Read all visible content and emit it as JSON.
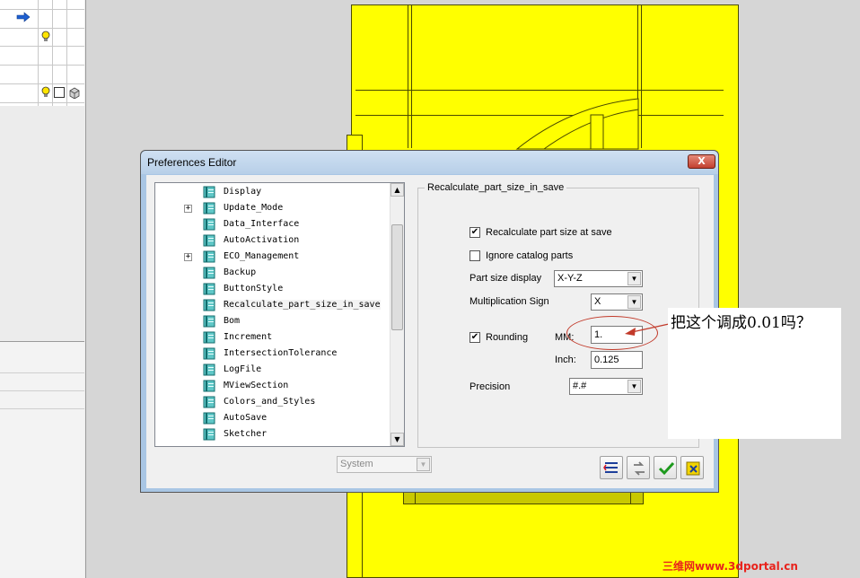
{
  "dialog": {
    "title": "Preferences Editor",
    "close_label": "X"
  },
  "tree": {
    "items": [
      {
        "label": "Display",
        "expandable": false
      },
      {
        "label": "Update_Mode",
        "expandable": true
      },
      {
        "label": "Data_Interface",
        "expandable": false
      },
      {
        "label": "AutoActivation",
        "expandable": false
      },
      {
        "label": "ECO_Management",
        "expandable": true
      },
      {
        "label": "Backup",
        "expandable": false
      },
      {
        "label": "ButtonStyle",
        "expandable": false
      },
      {
        "label": "Recalculate_part_size_in_save",
        "expandable": false,
        "selected": true
      },
      {
        "label": "Bom",
        "expandable": false
      },
      {
        "label": "Increment",
        "expandable": false
      },
      {
        "label": "IntersectionTolerance",
        "expandable": false
      },
      {
        "label": "LogFile",
        "expandable": false
      },
      {
        "label": "MViewSection",
        "expandable": false
      },
      {
        "label": "Colors_and_Styles",
        "expandable": false
      },
      {
        "label": "AutoSave",
        "expandable": false
      },
      {
        "label": "Sketcher",
        "expandable": false
      }
    ],
    "expand_symbol": "+"
  },
  "panel": {
    "group_title": "Recalculate_part_size_in_save",
    "recalc_label": "Recalculate part size at save",
    "recalc_checked": true,
    "ignore_label": "Ignore catalog parts",
    "ignore_checked": false,
    "part_size_label": "Part size display",
    "part_size_value": "X-Y-Z",
    "mult_label": "Multiplication Sign",
    "mult_value": "X",
    "rounding_label": "Rounding",
    "rounding_checked": true,
    "mm_label": "MM:",
    "mm_value": "1.",
    "inch_label": "Inch:",
    "inch_value": "0.125",
    "precision_label": "Precision",
    "precision_value": "#.#",
    "check_mark": "✔"
  },
  "footer": {
    "system_value": "System"
  },
  "annotation": {
    "text": "把这个调成0.01吗？"
  },
  "watermark": "三维网www.3dportal.cn",
  "colors": {
    "cad_yellow": "#ffff00",
    "title_blue": "#b7cfe8",
    "close_red": "#c24030",
    "annotation_red": "#c23a2a"
  }
}
